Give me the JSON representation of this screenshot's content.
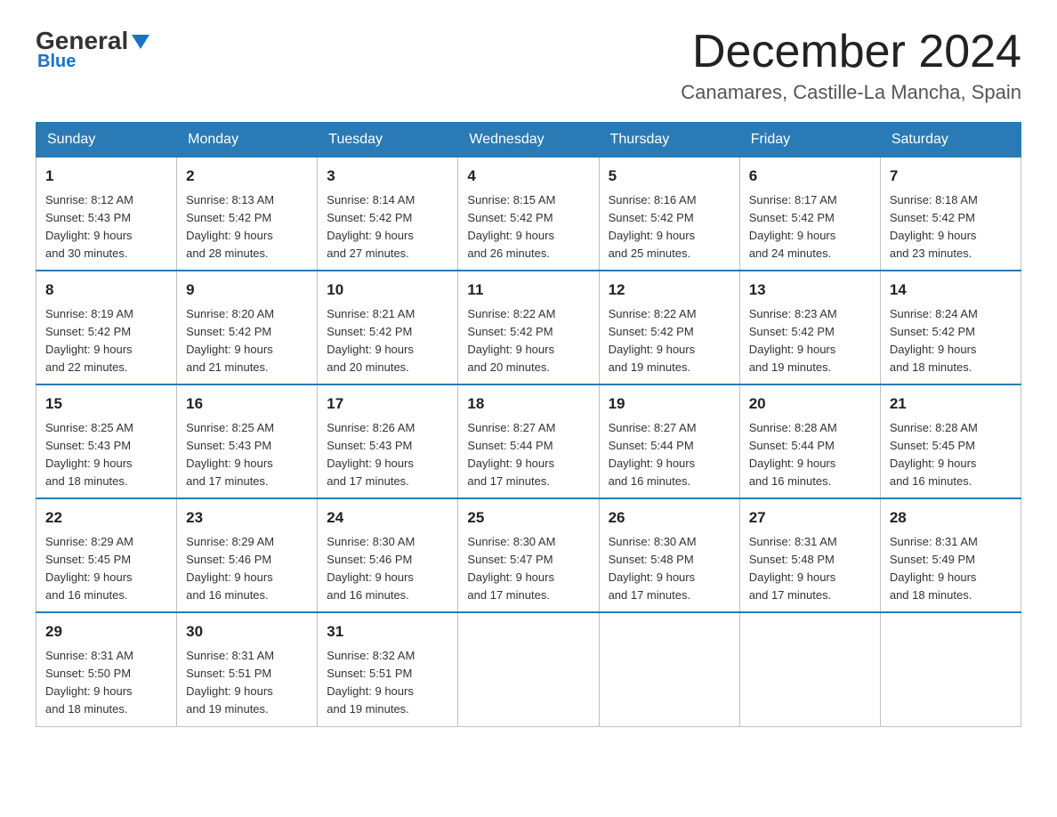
{
  "logo": {
    "general": "General",
    "blue": "Blue",
    "sub": "Blue"
  },
  "header": {
    "month": "December 2024",
    "location": "Canamares, Castille-La Mancha, Spain"
  },
  "weekdays": [
    "Sunday",
    "Monday",
    "Tuesday",
    "Wednesday",
    "Thursday",
    "Friday",
    "Saturday"
  ],
  "weeks": [
    [
      {
        "day": "1",
        "sunrise": "8:12 AM",
        "sunset": "5:43 PM",
        "daylight": "9 hours and 30 minutes."
      },
      {
        "day": "2",
        "sunrise": "8:13 AM",
        "sunset": "5:42 PM",
        "daylight": "9 hours and 28 minutes."
      },
      {
        "day": "3",
        "sunrise": "8:14 AM",
        "sunset": "5:42 PM",
        "daylight": "9 hours and 27 minutes."
      },
      {
        "day": "4",
        "sunrise": "8:15 AM",
        "sunset": "5:42 PM",
        "daylight": "9 hours and 26 minutes."
      },
      {
        "day": "5",
        "sunrise": "8:16 AM",
        "sunset": "5:42 PM",
        "daylight": "9 hours and 25 minutes."
      },
      {
        "day": "6",
        "sunrise": "8:17 AM",
        "sunset": "5:42 PM",
        "daylight": "9 hours and 24 minutes."
      },
      {
        "day": "7",
        "sunrise": "8:18 AM",
        "sunset": "5:42 PM",
        "daylight": "9 hours and 23 minutes."
      }
    ],
    [
      {
        "day": "8",
        "sunrise": "8:19 AM",
        "sunset": "5:42 PM",
        "daylight": "9 hours and 22 minutes."
      },
      {
        "day": "9",
        "sunrise": "8:20 AM",
        "sunset": "5:42 PM",
        "daylight": "9 hours and 21 minutes."
      },
      {
        "day": "10",
        "sunrise": "8:21 AM",
        "sunset": "5:42 PM",
        "daylight": "9 hours and 20 minutes."
      },
      {
        "day": "11",
        "sunrise": "8:22 AM",
        "sunset": "5:42 PM",
        "daylight": "9 hours and 20 minutes."
      },
      {
        "day": "12",
        "sunrise": "8:22 AM",
        "sunset": "5:42 PM",
        "daylight": "9 hours and 19 minutes."
      },
      {
        "day": "13",
        "sunrise": "8:23 AM",
        "sunset": "5:42 PM",
        "daylight": "9 hours and 19 minutes."
      },
      {
        "day": "14",
        "sunrise": "8:24 AM",
        "sunset": "5:42 PM",
        "daylight": "9 hours and 18 minutes."
      }
    ],
    [
      {
        "day": "15",
        "sunrise": "8:25 AM",
        "sunset": "5:43 PM",
        "daylight": "9 hours and 18 minutes."
      },
      {
        "day": "16",
        "sunrise": "8:25 AM",
        "sunset": "5:43 PM",
        "daylight": "9 hours and 17 minutes."
      },
      {
        "day": "17",
        "sunrise": "8:26 AM",
        "sunset": "5:43 PM",
        "daylight": "9 hours and 17 minutes."
      },
      {
        "day": "18",
        "sunrise": "8:27 AM",
        "sunset": "5:44 PM",
        "daylight": "9 hours and 17 minutes."
      },
      {
        "day": "19",
        "sunrise": "8:27 AM",
        "sunset": "5:44 PM",
        "daylight": "9 hours and 16 minutes."
      },
      {
        "day": "20",
        "sunrise": "8:28 AM",
        "sunset": "5:44 PM",
        "daylight": "9 hours and 16 minutes."
      },
      {
        "day": "21",
        "sunrise": "8:28 AM",
        "sunset": "5:45 PM",
        "daylight": "9 hours and 16 minutes."
      }
    ],
    [
      {
        "day": "22",
        "sunrise": "8:29 AM",
        "sunset": "5:45 PM",
        "daylight": "9 hours and 16 minutes."
      },
      {
        "day": "23",
        "sunrise": "8:29 AM",
        "sunset": "5:46 PM",
        "daylight": "9 hours and 16 minutes."
      },
      {
        "day": "24",
        "sunrise": "8:30 AM",
        "sunset": "5:46 PM",
        "daylight": "9 hours and 16 minutes."
      },
      {
        "day": "25",
        "sunrise": "8:30 AM",
        "sunset": "5:47 PM",
        "daylight": "9 hours and 17 minutes."
      },
      {
        "day": "26",
        "sunrise": "8:30 AM",
        "sunset": "5:48 PM",
        "daylight": "9 hours and 17 minutes."
      },
      {
        "day": "27",
        "sunrise": "8:31 AM",
        "sunset": "5:48 PM",
        "daylight": "9 hours and 17 minutes."
      },
      {
        "day": "28",
        "sunrise": "8:31 AM",
        "sunset": "5:49 PM",
        "daylight": "9 hours and 18 minutes."
      }
    ],
    [
      {
        "day": "29",
        "sunrise": "8:31 AM",
        "sunset": "5:50 PM",
        "daylight": "9 hours and 18 minutes."
      },
      {
        "day": "30",
        "sunrise": "8:31 AM",
        "sunset": "5:51 PM",
        "daylight": "9 hours and 19 minutes."
      },
      {
        "day": "31",
        "sunrise": "8:32 AM",
        "sunset": "5:51 PM",
        "daylight": "9 hours and 19 minutes."
      },
      null,
      null,
      null,
      null
    ]
  ],
  "labels": {
    "sunrise": "Sunrise:",
    "sunset": "Sunset:",
    "daylight": "Daylight:"
  }
}
